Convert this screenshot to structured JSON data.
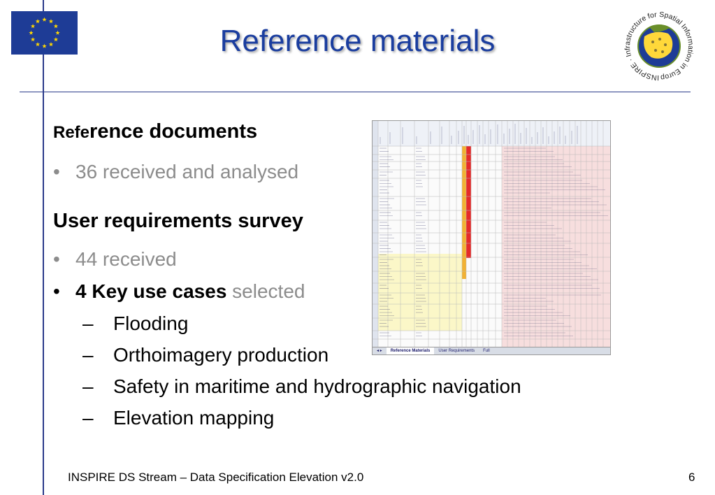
{
  "title": "Reference materials",
  "logo": {
    "text": "INSPIRE · Infrastructure for Spatial Information in Europe"
  },
  "section1": {
    "heading_lead": "Refe",
    "heading_rest": "rence documents",
    "bullet": "36 received and analysed"
  },
  "section2": {
    "heading": "User requirements survey",
    "bullet1": "44 received",
    "bullet2_strong": "4 Key use cases",
    "bullet2_rest": " selected",
    "use_cases": [
      "Flooding",
      "Orthoimagery production",
      "Safety in maritime and hydrographic navigation",
      "Elevation mapping"
    ]
  },
  "spreadsheet": {
    "tabs": [
      "Reference Materials",
      "User Requirements",
      "Full"
    ]
  },
  "footer": {
    "text": "INSPIRE DS Stream – Data Specification Elevation v2.0",
    "page": "6"
  },
  "colors": {
    "title": "#1a3d9f",
    "rule": "#2a3a8a",
    "flag": "#1e3c96",
    "star": "#ffd700",
    "muted": "#8c8c8c"
  }
}
